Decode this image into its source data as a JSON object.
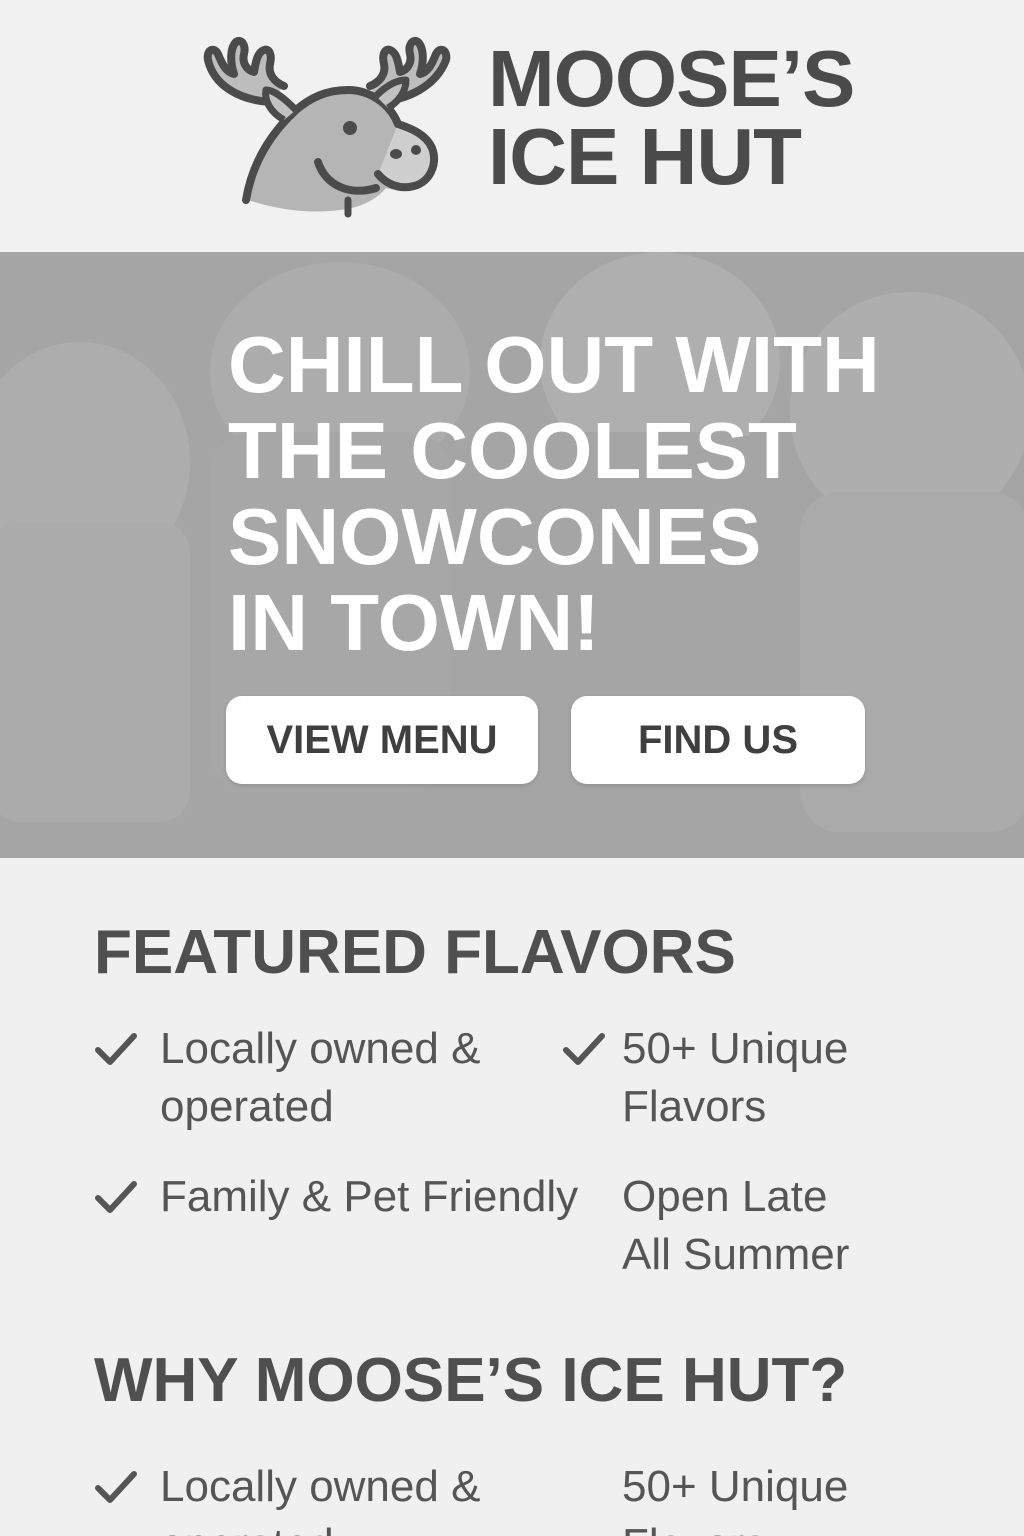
{
  "brand": {
    "line1": "MOOSE’S",
    "line2": "ICE HUT",
    "logo": "moose-head-logo"
  },
  "hero": {
    "title_lines": [
      "CHILL OUT WITH",
      "THE COOLEST",
      "SNOWCONES",
      "IN TOWN!"
    ],
    "buttons": {
      "view_menu": "VIEW MENU",
      "find_us": "FIND US"
    }
  },
  "featured": {
    "title": "FEATURED FLAVORS",
    "items": [
      {
        "lines": [
          "Locally owned &",
          "operated"
        ],
        "icon": "check-icon"
      },
      {
        "lines": [
          "50+ Unique",
          "Flavors"
        ],
        "icon": "check-icon"
      },
      {
        "lines": [
          "Family & Pet Friendly"
        ],
        "icon": "check-icon"
      },
      {
        "lines": [
          "Open Late",
          "All Summer"
        ],
        "icon": ""
      }
    ]
  },
  "why": {
    "title": "WHY MOOSE’S ICE HUT?",
    "items": [
      {
        "lines": [
          "Locally owned &",
          "operated"
        ],
        "icon": "check-icon"
      },
      {
        "lines": [
          "50+ Unique",
          "Flavors"
        ],
        "icon": ""
      }
    ]
  },
  "colors": {
    "header_bg": "#f1f1f1",
    "hero_bg": "#a9a9a9",
    "text": "#4a4a4a",
    "button_bg": "#ffffff"
  }
}
